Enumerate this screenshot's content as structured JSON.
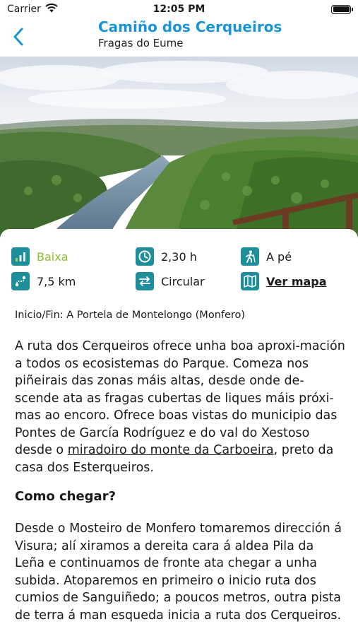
{
  "status": {
    "carrier": "Carrier",
    "time": "12:05 PM"
  },
  "nav": {
    "title": "Camiño dos Cerqueiros",
    "subtitle": "Fragas do Eume"
  },
  "info": {
    "difficulty": "Baixa",
    "duration": "2,30 h",
    "mode": "A pé",
    "distance": "7,5 km",
    "route_type": "Circular",
    "map_link": "Ver mapa"
  },
  "colors": {
    "accent": "#1a94d6",
    "difficulty": "#8cbf2e",
    "icon_teal": "#1e8f9a"
  },
  "route": {
    "start_end": "Inicio/Fin: A Portela de Montelongo (Monfero)",
    "desc_before": "A ruta dos Cerqueiros ofrece unha boa aproxi-mación a todos os ecosistemas do Parque. Comeza nos piñeirais das zonas máis altas, desde onde de-scende ata as fragas cubertas de liques máis próxi-mas ao encoro. Ofrece boas vistas do municipio das Pontes de García Rodríguez e do val do Xestoso desde o ",
    "desc_link": "miradoiro do monte da Carboeira",
    "desc_after": ", preto da casa dos Esterqueiros.",
    "howto_title": "Como chegar?",
    "howto_text": "Desde o Mosteiro de Monfero tomaremos dirección á Visura; alí xiramos a dereita cara á aldea Pila da Leña e continuamos de fronte ata chegar a unha subida. Atoparemos en primeiro o inicio ruta dos cumios de Sanguiñedo; a poucos metros, outra pista de terra á man esqueda inicia a ruta dos Cerqueiros."
  }
}
